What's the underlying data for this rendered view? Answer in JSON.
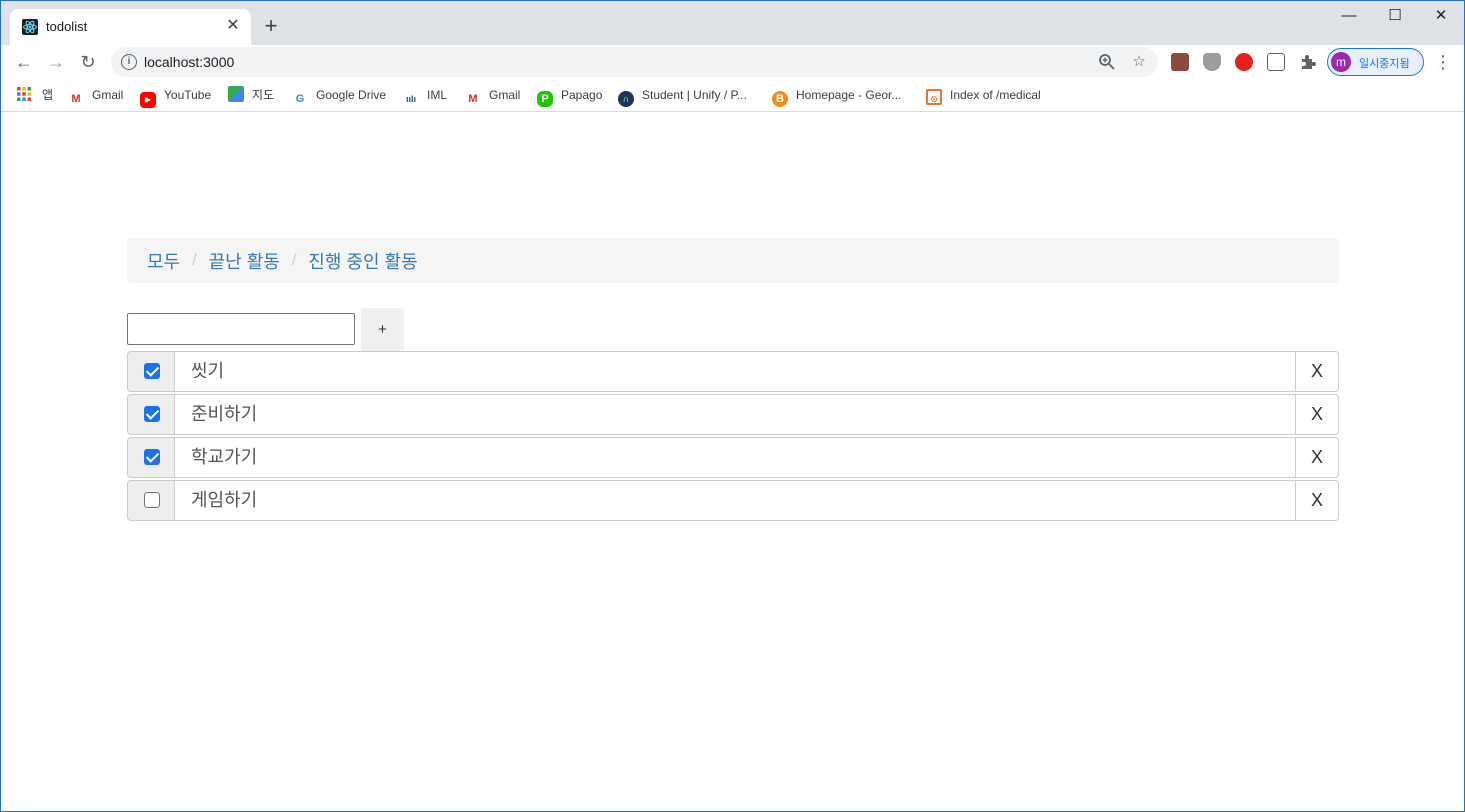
{
  "browser": {
    "tab_title": "todolist",
    "tab_close": "✕",
    "new_tab": "+",
    "window_controls": {
      "minimize": "—",
      "maximize": "☐",
      "close": "✕"
    },
    "url": "localhost:3000",
    "profile_initial": "m",
    "profile_label": "일시중지됨"
  },
  "bookmarks": [
    {
      "label": "앱",
      "icon": "apps-grid-icon"
    },
    {
      "label": "Gmail",
      "icon": "gmail-icon"
    },
    {
      "label": "YouTube",
      "icon": "youtube-icon"
    },
    {
      "label": "지도",
      "icon": "maps-icon"
    },
    {
      "label": "Google Drive",
      "icon": "google-icon"
    },
    {
      "label": "IML",
      "icon": "iml-icon"
    },
    {
      "label": "Gmail",
      "icon": "gmail-icon"
    },
    {
      "label": "Papago",
      "icon": "papago-icon"
    },
    {
      "label": "Student | Unify / P...",
      "icon": "unify-icon"
    },
    {
      "label": "Homepage - Geor...",
      "icon": "homepage-icon"
    },
    {
      "label": "Index of /medical",
      "icon": "index-icon"
    }
  ],
  "filters": {
    "all": "모두",
    "done": "끝난 활동",
    "in_progress": "진행 중인 활동",
    "separator": "/"
  },
  "add_form": {
    "input_value": "",
    "button_label": "+"
  },
  "todos": [
    {
      "text": "씻기",
      "done": true,
      "delete_label": "X"
    },
    {
      "text": "준비하기",
      "done": true,
      "delete_label": "X"
    },
    {
      "text": "학교가기",
      "done": true,
      "delete_label": "X"
    },
    {
      "text": "게임하기",
      "done": false,
      "delete_label": "X"
    }
  ],
  "colors": {
    "link": "#337ab7",
    "checkbox_checked": "#1a73e8",
    "breadcrumb_bg": "#f5f5f5"
  }
}
